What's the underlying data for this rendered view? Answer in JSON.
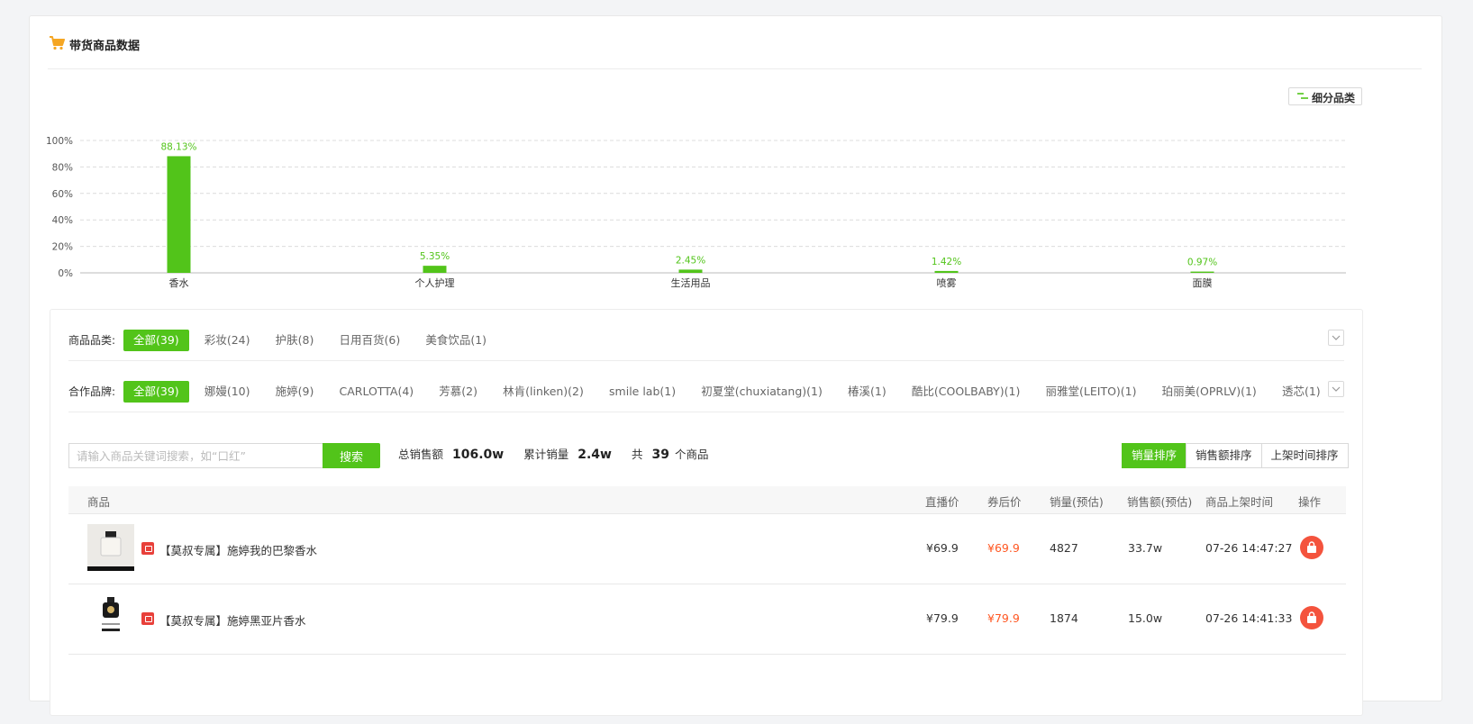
{
  "header": {
    "title": "带货商品数据",
    "subcategory_button": "细分品类"
  },
  "colors": {
    "accent": "#52c41a",
    "price_after": "#ff5722",
    "op_button": "#f4533d"
  },
  "chart_data": {
    "type": "bar",
    "categories": [
      "香水",
      "个人护理",
      "生活用品",
      "喷雾",
      "面膜"
    ],
    "values": [
      88.13,
      5.35,
      2.45,
      1.42,
      0.97
    ],
    "value_labels": [
      "88.13%",
      "5.35%",
      "2.45%",
      "1.42%",
      "0.97%"
    ],
    "ylim": [
      0,
      100
    ],
    "y_ticks": [
      "0%",
      "20%",
      "40%",
      "60%",
      "80%",
      "100%"
    ],
    "grid": true,
    "color": "#52c41a"
  },
  "filters": {
    "category": {
      "label": "商品品类:",
      "options": [
        "全部(39)",
        "彩妆(24)",
        "护肤(8)",
        "日用百货(6)",
        "美食饮品(1)"
      ]
    },
    "brand": {
      "label": "合作品牌:",
      "options": [
        "全部(39)",
        "娜嫚(10)",
        "施婷(9)",
        "CARLOTTA(4)",
        "芳慕(2)",
        "林肯(linken)(2)",
        "smile lab(1)",
        "初夏堂(chuxiatang)(1)",
        "椿溪(1)",
        "酷比(COOLBABY)(1)",
        "丽雅堂(LEITO)(1)",
        "珀丽美(OPRLV)(1)",
        "透芯(1)"
      ]
    }
  },
  "search": {
    "placeholder": "请输入商品关键词搜索，如“口红”",
    "button": "搜索"
  },
  "stats": {
    "total_sales_label": "总销售额",
    "total_sales": "106.0w",
    "cum_volume_label": "累计销量",
    "cum_volume": "2.4w",
    "count_prefix": "共",
    "count": "39",
    "count_suffix": "个商品"
  },
  "sort": {
    "options": [
      "销量排序",
      "销售额排序",
      "上架时间排序"
    ],
    "active": "销量排序"
  },
  "table": {
    "headers": [
      "商品",
      "直播价",
      "券后价",
      "销量(预估)",
      "销售额(预估)",
      "商品上架时间",
      "操作"
    ],
    "rows": [
      {
        "name": "【莫叔专属】施婷我的巴黎香水",
        "live_price": "¥69.9",
        "coupon_price": "¥69.9",
        "volume": "4827",
        "sales": "33.7w",
        "time": "07-26 14:47:27"
      },
      {
        "name": "【莫叔专属】施婷黑亚片香水",
        "live_price": "¥79.9",
        "coupon_price": "¥79.9",
        "volume": "1874",
        "sales": "15.0w",
        "time": "07-26 14:41:33"
      }
    ]
  }
}
